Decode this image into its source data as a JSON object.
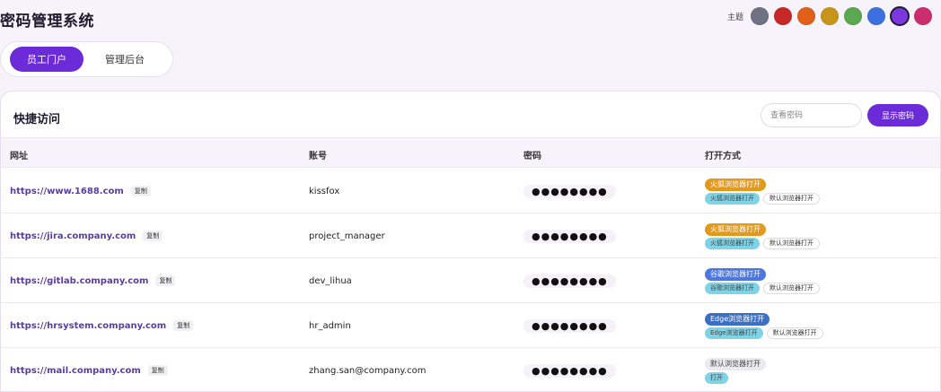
{
  "app": {
    "title": "密码管理系统"
  },
  "theme": {
    "label": "主题",
    "colors": [
      "#6e7283",
      "#c62828",
      "#e0601a",
      "#c8951a",
      "#5aa84f",
      "#3d6fe0",
      "#7b38e0",
      "#cc2d6f"
    ],
    "active_index": 6
  },
  "tabs": [
    {
      "label": "员工门户",
      "active": true
    },
    {
      "label": "管理后台",
      "active": false
    }
  ],
  "quick_access": {
    "title": "快捷访问",
    "search_placeholder": "查看密码",
    "show_button": "显示密码",
    "columns": [
      "网址",
      "账号",
      "密码",
      "打开方式"
    ],
    "copy_label": "复制",
    "rows": [
      {
        "url": "https://www.1688.com",
        "account": "kissfox",
        "password": "●●●●●●●●",
        "open_primary": "火狐浏览器打开",
        "primary_color": "#e39a1c",
        "open_secondary": "火狐浏览器打开",
        "open_default": "默认浏览器打开"
      },
      {
        "url": "https://jira.company.com",
        "account": "project_manager",
        "password": "●●●●●●●●",
        "open_primary": "火狐浏览器打开",
        "primary_color": "#e39a1c",
        "open_secondary": "火狐浏览器打开",
        "open_default": "默认浏览器打开"
      },
      {
        "url": "https://gitlab.company.com",
        "account": "dev_lihua",
        "password": "●●●●●●●●",
        "open_primary": "谷歌浏览器打开",
        "primary_color": "#4a78e0",
        "open_secondary": "谷歌浏览器打开",
        "open_default": "默认浏览器打开"
      },
      {
        "url": "https://hrsystem.company.com",
        "account": "hr_admin",
        "password": "●●●●●●●●",
        "open_primary": "Edge浏览器打开",
        "primary_color": "#3a6fc4",
        "open_secondary": "Edge浏览器打开",
        "open_default": "默认浏览器打开"
      },
      {
        "url": "https://mail.company.com",
        "account": "zhang.san@company.com",
        "password": "●●●●●●●●",
        "open_primary": "默认浏览器打开",
        "primary_color": "",
        "open_secondary": "打开",
        "open_default": ""
      }
    ]
  }
}
